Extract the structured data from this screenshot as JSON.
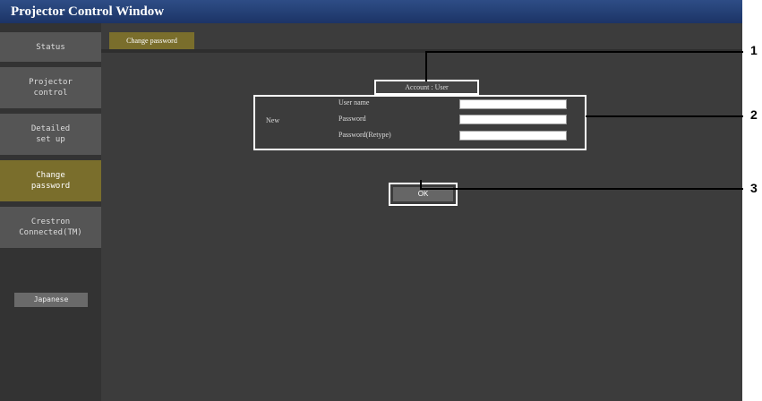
{
  "window": {
    "title": "Projector Control Window"
  },
  "sidebar": {
    "items": [
      {
        "label": "Status",
        "active": false
      },
      {
        "label": "Projector\ncontrol",
        "active": false
      },
      {
        "label": "Detailed\nset up",
        "active": false
      },
      {
        "label": "Change\npassword",
        "active": true
      },
      {
        "label": "Crestron\nConnected(TM)",
        "active": false
      }
    ],
    "language_button": "Japanese"
  },
  "main": {
    "tab_label": "Change password",
    "account_label": "Account : User",
    "new_label": "New",
    "fields": [
      {
        "label": "User name",
        "value": ""
      },
      {
        "label": "Password",
        "value": ""
      },
      {
        "label": "Password(Retype)",
        "value": ""
      }
    ],
    "ok_button": "OK"
  },
  "callouts": [
    "1",
    "2",
    "3"
  ],
  "colors": {
    "titlebar": "#1c3466",
    "active_nav": "#7a6e2c",
    "background": "#3c3c3c"
  }
}
